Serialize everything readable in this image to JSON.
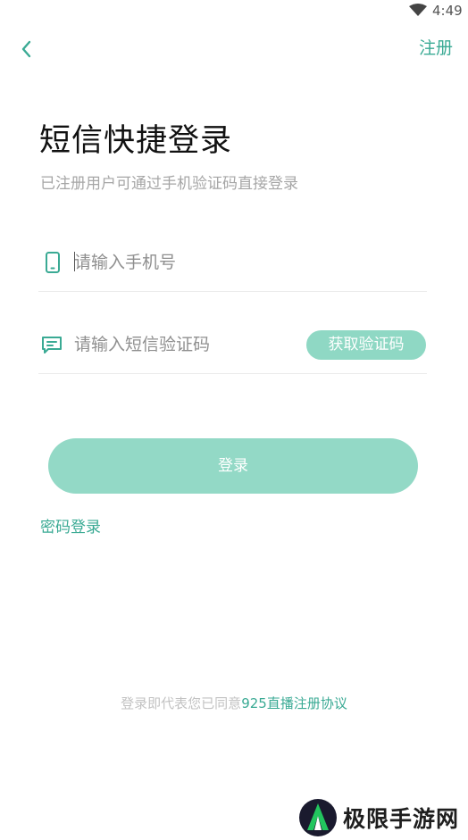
{
  "status_bar": {
    "time": "4:49",
    "wifi_icon": "wifi-icon"
  },
  "header": {
    "back_icon": "chevron-left-icon",
    "register_label": "注册"
  },
  "title": "短信快捷登录",
  "subtitle": "已注册用户可通过手机验证码直接登录",
  "phone_input": {
    "icon": "phone-icon",
    "placeholder": "请输入手机号",
    "value": ""
  },
  "code_input": {
    "icon": "message-icon",
    "placeholder": "请输入短信验证码",
    "value": "",
    "get_code_label": "获取验证码"
  },
  "login_button_label": "登录",
  "password_login_label": "密码登录",
  "agreement": {
    "prefix": "登录即代表您已同意",
    "link": "925直播注册协议"
  },
  "watermark": {
    "text": "极限手游网"
  },
  "colors": {
    "accent": "#3aaa94",
    "button_fill": "#93d9c6",
    "code_button_fill": "#8fd8c4",
    "placeholder": "#8f8f8f"
  }
}
